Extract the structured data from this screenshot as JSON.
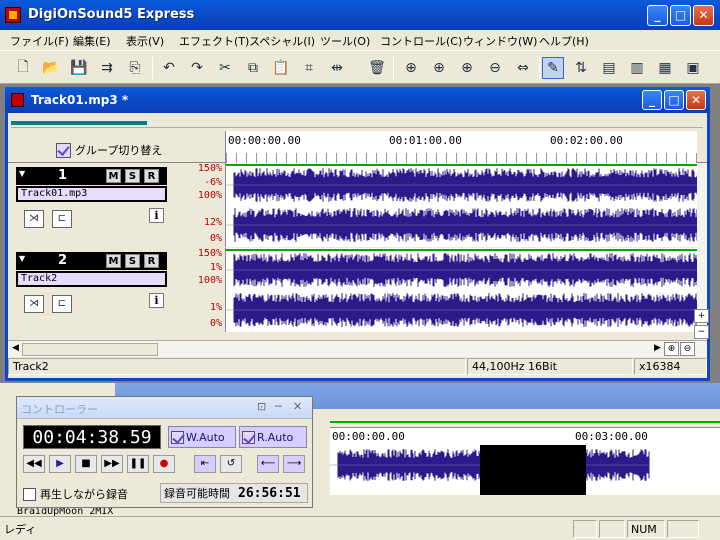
{
  "app": {
    "title": "DigiOnSound5 Express"
  },
  "menu": [
    "ファイル(F)",
    "編集(E)",
    "表示(V)",
    "エフェクト(T)",
    "スペシャル(I)",
    "ツール(O)",
    "コントロール(C)",
    "ウィンドウ(W)",
    "ヘルプ(H)"
  ],
  "toolbar_icons": [
    "new-file-icon",
    "open-folder-icon",
    "save-icon",
    "record-to-file-icon",
    "export-icon",
    "undo-icon",
    "redo-icon",
    "cut-icon",
    "copy-icon",
    "paste-icon",
    "crop-icon",
    "insert-icon",
    "delete-icon",
    "zoom-in-icon",
    "zoom-all-icon",
    "zoom-sel-icon",
    "zoom-out-icon",
    "fit-icon",
    "pencil-icon",
    "mixer-icon",
    "meter-icon",
    "list-icon",
    "snap-icon",
    "monitor-icon"
  ],
  "track_window": {
    "title": "Track01.mp3 *",
    "group_toggle": "グループ切り替え",
    "ruler": [
      "00:00:00.00",
      "00:01:00.00",
      "00:02:00.00"
    ],
    "tracks": [
      {
        "number": "1",
        "name": "Track01.mp3",
        "m": "M",
        "s": "S",
        "r": "R",
        "db_labels": [
          "150%",
          "-6%",
          "100%",
          "12%",
          "0%"
        ]
      },
      {
        "number": "2",
        "name": "Track2",
        "m": "M",
        "s": "S",
        "r": "R",
        "db_labels": [
          "150%",
          "1%",
          "100%",
          "1%",
          "0%"
        ]
      }
    ],
    "status": {
      "track": "Track2",
      "format": "44,100Hz 16Bit",
      "zoom": "x16384"
    }
  },
  "second_window": {
    "ruler": [
      "00:00:00.00",
      "00:03:00.00"
    ],
    "track_name": "BraidUpMoon 2MIX"
  },
  "controller": {
    "title": "コントローラー",
    "time": "00:04:38.59",
    "w_auto": "W.Auto",
    "r_auto": "R.Auto",
    "rec_while_play": "再生しながら録音",
    "rec_avail_label": "録音可能時間",
    "rec_avail_value": "26:56:51"
  },
  "statusbar": {
    "text": "レディ",
    "num": "NUM"
  }
}
